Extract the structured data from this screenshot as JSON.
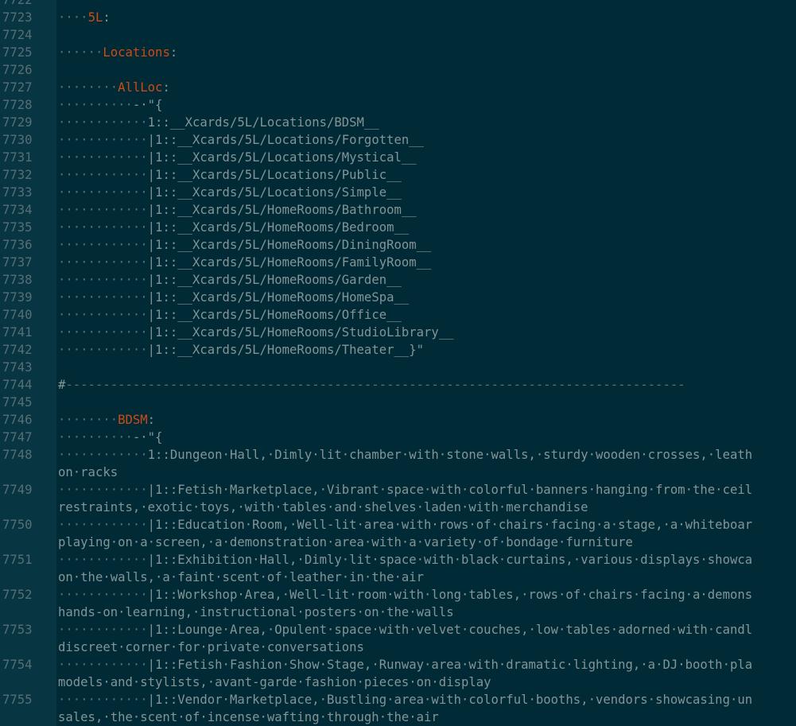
{
  "colors": {
    "background": "#002b36",
    "gutter_background": "#073642",
    "gutter_text": "#586e75",
    "text": "#839496",
    "whitespace_marker": "#586e75",
    "yaml_key": "#cb4b16"
  },
  "editor": {
    "lines": [
      {
        "num": "7722",
        "parts": []
      },
      {
        "num": "7723",
        "parts": [
          {
            "t": "····",
            "k": "ws"
          },
          {
            "t": "5L",
            "k": "key"
          },
          {
            "t": ":",
            "k": "punct"
          }
        ]
      },
      {
        "num": "7724",
        "parts": []
      },
      {
        "num": "7725",
        "parts": [
          {
            "t": "······",
            "k": "ws"
          },
          {
            "t": "Locations",
            "k": "key"
          },
          {
            "t": ":",
            "k": "punct"
          }
        ]
      },
      {
        "num": "7726",
        "parts": []
      },
      {
        "num": "7727",
        "parts": [
          {
            "t": "········",
            "k": "ws"
          },
          {
            "t": "AllLoc",
            "k": "key"
          },
          {
            "t": ":",
            "k": "punct"
          }
        ]
      },
      {
        "num": "7728",
        "parts": [
          {
            "t": "··········",
            "k": "ws"
          },
          {
            "t": "-·\"{",
            "k": "text"
          }
        ]
      },
      {
        "num": "7729",
        "parts": [
          {
            "t": "············",
            "k": "ws"
          },
          {
            "t": "1::__Xcards/5L/Locations/BDSM__",
            "k": "text"
          }
        ]
      },
      {
        "num": "7730",
        "parts": [
          {
            "t": "············",
            "k": "ws"
          },
          {
            "t": "|1::__Xcards/5L/Locations/Forgotten__",
            "k": "text"
          }
        ]
      },
      {
        "num": "7731",
        "parts": [
          {
            "t": "············",
            "k": "ws"
          },
          {
            "t": "|1::__Xcards/5L/Locations/Mystical__",
            "k": "text"
          }
        ]
      },
      {
        "num": "7732",
        "parts": [
          {
            "t": "············",
            "k": "ws"
          },
          {
            "t": "|1::__Xcards/5L/Locations/Public__",
            "k": "text"
          }
        ]
      },
      {
        "num": "7733",
        "parts": [
          {
            "t": "············",
            "k": "ws"
          },
          {
            "t": "|1::__Xcards/5L/Locations/Simple__",
            "k": "text"
          }
        ]
      },
      {
        "num": "7734",
        "parts": [
          {
            "t": "············",
            "k": "ws"
          },
          {
            "t": "|1::__Xcards/5L/HomeRooms/Bathroom__",
            "k": "text"
          }
        ]
      },
      {
        "num": "7735",
        "parts": [
          {
            "t": "············",
            "k": "ws"
          },
          {
            "t": "|1::__Xcards/5L/HomeRooms/Bedroom__",
            "k": "text"
          }
        ]
      },
      {
        "num": "7736",
        "parts": [
          {
            "t": "············",
            "k": "ws"
          },
          {
            "t": "|1::__Xcards/5L/HomeRooms/DiningRoom__",
            "k": "text"
          }
        ]
      },
      {
        "num": "7737",
        "parts": [
          {
            "t": "············",
            "k": "ws"
          },
          {
            "t": "|1::__Xcards/5L/HomeRooms/FamilyRoom__",
            "k": "text"
          }
        ]
      },
      {
        "num": "7738",
        "parts": [
          {
            "t": "············",
            "k": "ws"
          },
          {
            "t": "|1::__Xcards/5L/HomeRooms/Garden__",
            "k": "text"
          }
        ]
      },
      {
        "num": "7739",
        "parts": [
          {
            "t": "············",
            "k": "ws"
          },
          {
            "t": "|1::__Xcards/5L/HomeRooms/HomeSpa__",
            "k": "text"
          }
        ]
      },
      {
        "num": "7740",
        "parts": [
          {
            "t": "············",
            "k": "ws"
          },
          {
            "t": "|1::__Xcards/5L/HomeRooms/Office__",
            "k": "text"
          }
        ]
      },
      {
        "num": "7741",
        "parts": [
          {
            "t": "············",
            "k": "ws"
          },
          {
            "t": "|1::__Xcards/5L/HomeRooms/StudioLibrary__",
            "k": "text"
          }
        ]
      },
      {
        "num": "7742",
        "parts": [
          {
            "t": "············",
            "k": "ws"
          },
          {
            "t": "|1::__Xcards/5L/HomeRooms/Theater__}\"",
            "k": "text"
          }
        ]
      },
      {
        "num": "7743",
        "parts": []
      },
      {
        "num": "7744",
        "parts": [
          {
            "t": "#",
            "k": "text"
          },
          {
            "t": "-----------------------------------------------------------------------------------",
            "k": "ws"
          }
        ]
      },
      {
        "num": "7745",
        "parts": []
      },
      {
        "num": "7746",
        "parts": [
          {
            "t": "········",
            "k": "ws"
          },
          {
            "t": "BDSM",
            "k": "key"
          },
          {
            "t": ":",
            "k": "punct"
          }
        ]
      },
      {
        "num": "7747",
        "parts": [
          {
            "t": "··········",
            "k": "ws"
          },
          {
            "t": "-·\"{",
            "k": "text"
          }
        ]
      },
      {
        "num": "7748",
        "parts": [
          {
            "t": "············",
            "k": "ws"
          },
          {
            "t": "1::Dungeon·Hall,·Dimly·lit·chamber·with·stone·walls,·sturdy·wooden·crosses,·leath",
            "k": "text"
          }
        ],
        "wrap": "on·racks"
      },
      {
        "num": "7749",
        "parts": [
          {
            "t": "············",
            "k": "ws"
          },
          {
            "t": "|1::Fetish·Marketplace,·Vibrant·space·with·colorful·banners·hanging·from·the·ceil",
            "k": "text"
          }
        ],
        "wrap": "restraints,·exotic·toys,·with·tables·and·shelves·laden·with·merchandise"
      },
      {
        "num": "7750",
        "parts": [
          {
            "t": "············",
            "k": "ws"
          },
          {
            "t": "|1::Education·Room,·Well-lit·area·with·rows·of·chairs·facing·a·stage,·a·whiteboar",
            "k": "text"
          }
        ],
        "wrap": "playing·on·a·screen,·a·demonstration·area·with·a·variety·of·bondage·furniture"
      },
      {
        "num": "7751",
        "parts": [
          {
            "t": "············",
            "k": "ws"
          },
          {
            "t": "|1::Exhibition·Hall,·Dimly·lit·space·with·black·curtains,·various·displays·showca",
            "k": "text"
          }
        ],
        "wrap": "on·the·walls,·a·faint·scent·of·leather·in·the·air"
      },
      {
        "num": "7752",
        "parts": [
          {
            "t": "············",
            "k": "ws"
          },
          {
            "t": "|1::Workshop·Area,·Well-lit·room·with·long·tables,·rows·of·chairs·facing·a·demons",
            "k": "text"
          }
        ],
        "wrap": "hands-on·learning,·instructional·posters·on·the·walls"
      },
      {
        "num": "7753",
        "parts": [
          {
            "t": "············",
            "k": "ws"
          },
          {
            "t": "|1::Lounge·Area,·Opulent·space·with·velvet·couches,·low·tables·adorned·with·candl",
            "k": "text"
          }
        ],
        "wrap": "discreet·corner·for·private·conversations"
      },
      {
        "num": "7754",
        "parts": [
          {
            "t": "············",
            "k": "ws"
          },
          {
            "t": "|1::Fetish·Fashion·Show·Stage,·Runway·area·with·dramatic·lighting,·a·DJ·booth·pla",
            "k": "text"
          }
        ],
        "wrap": "models·and·stylists,·avant-garde·fashion·pieces·on·display"
      },
      {
        "num": "7755",
        "parts": [
          {
            "t": "············",
            "k": "ws"
          },
          {
            "t": "|1::Vendor·Marketplace,·Bustling·area·with·colorful·booths,·vendors·showcasing·un",
            "k": "text"
          }
        ],
        "wrap": "sales,·the·scent·of·incense·wafting·through·the·air"
      }
    ]
  }
}
